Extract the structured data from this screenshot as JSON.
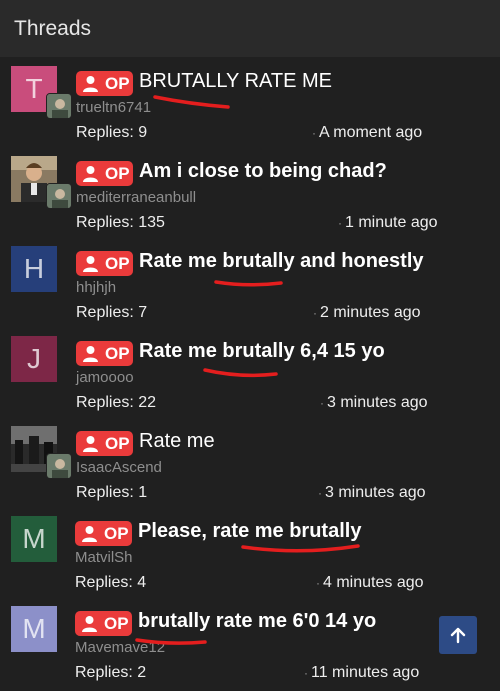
{
  "header": {
    "title": "Threads"
  },
  "op_label": "OP",
  "threads": [
    {
      "avatar_letter": "T",
      "avatar_color": "#c94d7c",
      "title": "BRUTALLY RATE ME",
      "title_bold": false,
      "user": "trueltn6741",
      "replies": "Replies: 9",
      "time": "A moment ago"
    },
    {
      "avatar_letter": "",
      "avatar_color": "#7a6a55",
      "title": "Am i close to being chad?",
      "title_bold": true,
      "user": "mediterraneanbull",
      "replies": "Replies: 135",
      "time": "1 minute ago"
    },
    {
      "avatar_letter": "H",
      "avatar_color": "#263f7a",
      "title": "Rate me brutally and honestly",
      "title_bold": true,
      "user": "hhjhjh",
      "replies": "Replies: 7",
      "time": "2 minutes ago"
    },
    {
      "avatar_letter": "J",
      "avatar_color": "#7d2747",
      "title": "Rate me brutally 6,4 15 yo",
      "title_bold": true,
      "user": "jamoooo",
      "replies": "Replies: 22",
      "time": "3 minutes ago"
    },
    {
      "avatar_letter": "",
      "avatar_color": "#3b3b3b",
      "title": "Rate me",
      "title_bold": false,
      "user": "IsaacAscend",
      "replies": "Replies: 1",
      "time": "3 minutes ago"
    },
    {
      "avatar_letter": "M",
      "avatar_color": "#235d3b",
      "title": "Please, rate me brutally",
      "title_bold": true,
      "user": "MatvilSh",
      "replies": "Replies: 4",
      "time": "4 minutes ago"
    },
    {
      "avatar_letter": "M",
      "avatar_color": "#8c90c9",
      "title": "brutally rate me 6'0 14 yo",
      "title_bold": true,
      "user": "Mavemave12",
      "replies": "Replies: 2",
      "time": "11 minutes ago"
    }
  ],
  "colors": {
    "background": "#202020",
    "header": "#2a2a2a",
    "op_badge": "#ea3b3b",
    "annotation": "#e41e1e",
    "fab": "#2d4b86"
  },
  "icons": {
    "op": "user-icon",
    "scroll_top": "arrow-up-icon"
  }
}
